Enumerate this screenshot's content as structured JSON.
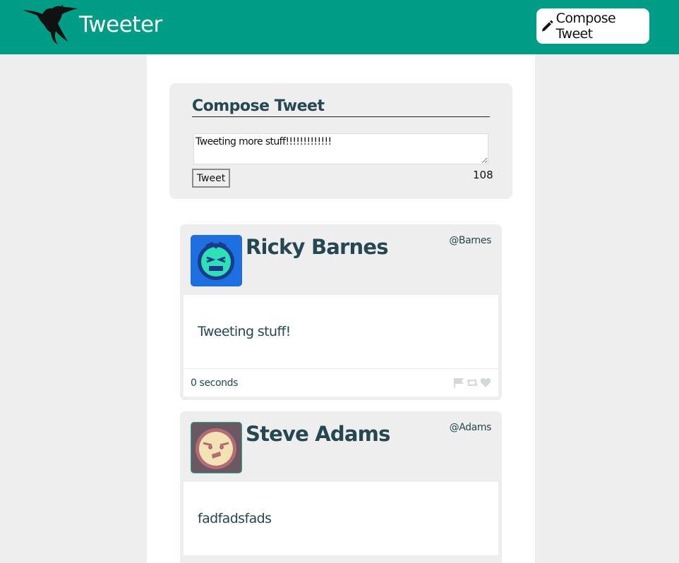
{
  "header": {
    "brand": "Tweeter",
    "compose_button_label": "Compose Tweet",
    "logo_icon": "hummingbird-icon",
    "compose_icon": "pencil-icon"
  },
  "compose": {
    "title": "Compose Tweet",
    "textarea_value": "Tweeting more stuff!!!!!!!!!!!!!",
    "submit_label": "Tweet",
    "char_counter": "108"
  },
  "tweets": [
    {
      "name": "Ricky Barnes",
      "handle": "@Barnes",
      "content": "Tweeting stuff!",
      "age": "0 seconds",
      "avatar_colors": {
        "bg": "#1e6fe0",
        "face": "#2de0b6",
        "border": "#1a3a8a"
      }
    },
    {
      "name": "Steve Adams",
      "handle": "@Adams",
      "content": "fadfadsfads",
      "age": "",
      "avatar_colors": {
        "bg": "#6b5862",
        "face": "#f3e2b4",
        "border": "#b26c74"
      }
    }
  ],
  "tweet_actions": [
    "flag-icon",
    "retweet-icon",
    "heart-icon"
  ],
  "colors": {
    "accent": "#009d86",
    "text": "#244751",
    "panel": "#eeeeee"
  }
}
